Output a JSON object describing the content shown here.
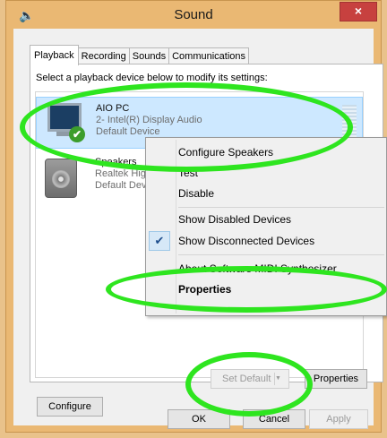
{
  "window": {
    "title": "Sound",
    "icon": "speaker-icon",
    "close_icon": "close-icon",
    "close_glyph": "×"
  },
  "tabs": [
    {
      "label": "Playback",
      "active": true
    },
    {
      "label": "Recording",
      "active": false
    },
    {
      "label": "Sounds",
      "active": false
    },
    {
      "label": "Communications",
      "active": false
    }
  ],
  "panel": {
    "instruction": "Select a playback device below to modify its settings:"
  },
  "devices": [
    {
      "name": "AIO PC",
      "description": "2- Intel(R) Display Audio",
      "status": "Default Device",
      "icon": "monitor-icon",
      "selected": true
    },
    {
      "name": "Speakers",
      "description": "Realtek High Definition Audio",
      "status": "Default Device",
      "icon": "speaker-icon",
      "selected": false
    }
  ],
  "context_menu": {
    "items": [
      {
        "label": "Configure Speakers"
      },
      {
        "label": "Test"
      },
      {
        "label": "Disable"
      },
      {
        "label": "Show Disabled Devices"
      },
      {
        "label": "Show Disconnected Devices",
        "checked": true
      },
      {
        "label": "About Software MIDI Synthesizer"
      },
      {
        "label": "Properties",
        "bold": true
      }
    ]
  },
  "panel_buttons": {
    "configure": "Configure",
    "set_default": "Set Default",
    "properties": "Properties"
  },
  "dialog_buttons": {
    "ok": "OK",
    "cancel": "Cancel",
    "apply": "Apply"
  },
  "colors": {
    "title_bar": "#eab873",
    "selection": "#cde8ff",
    "highlight_annotation": "#2ee51f",
    "close_button": "#c7413f"
  }
}
